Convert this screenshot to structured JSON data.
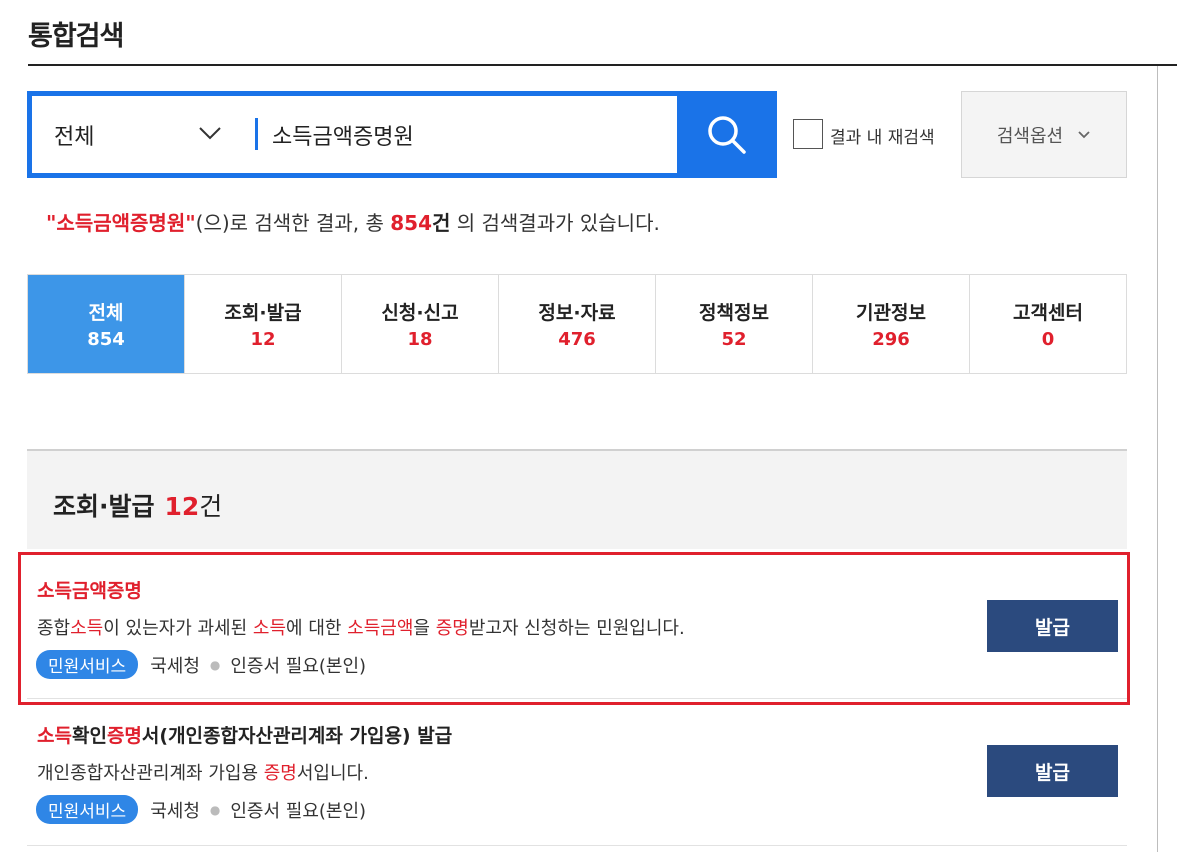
{
  "header": {
    "title": "통합검색"
  },
  "search": {
    "scope_label": "전체",
    "query_value": "소득금액증명원",
    "research_label": "결과 내 재검색",
    "options_label": "검색옵션"
  },
  "summary": {
    "query": "\"소득금액증명원\"",
    "text1": "(으)로 검색한 결과, 총 ",
    "count": "854",
    "unit": "건",
    "text2": " 의 검색결과가 있습니다."
  },
  "tabs": [
    {
      "label": "전체",
      "count": "854"
    },
    {
      "label": "조회·발급",
      "count": "12"
    },
    {
      "label": "신청·신고",
      "count": "18"
    },
    {
      "label": "정보·자료",
      "count": "476"
    },
    {
      "label": "정책정보",
      "count": "52"
    },
    {
      "label": "기관정보",
      "count": "296"
    },
    {
      "label": "고객센터",
      "count": "0"
    }
  ],
  "section": {
    "title": "조회·발급",
    "count": "12",
    "unit": "건"
  },
  "results": [
    {
      "title": "소득금액증명",
      "desc": {
        "p1": "종합",
        "h1": "소득",
        "p2": "이 있는자가 과세된 ",
        "h2": "소득",
        "p3": "에 대한 ",
        "h3": "소득금액",
        "p4": "을 ",
        "h4": "증명",
        "p5": "받고자 신청하는 민원입니다."
      },
      "badge": "민원서비스",
      "agency": "국세청",
      "cert": "인증서 필요(본인)",
      "button": "발급"
    },
    {
      "title": {
        "h1": "소득",
        "p1": "확인",
        "h2": "증명",
        "p2": "서(개인종합자산관리계좌 가입용) 발급"
      },
      "desc": {
        "p1": "개인종합자산관리계좌 가입용 ",
        "h1": "증명",
        "p2": "서입니다."
      },
      "badge": "민원서비스",
      "agency": "국세청",
      "cert": "인증서 필요(본인)",
      "button": "발급"
    }
  ],
  "colors": {
    "accent": "#1a73e8",
    "highlight": "#e0202d",
    "button": "#2b4a7e",
    "active_tab": "#3d96e8"
  }
}
